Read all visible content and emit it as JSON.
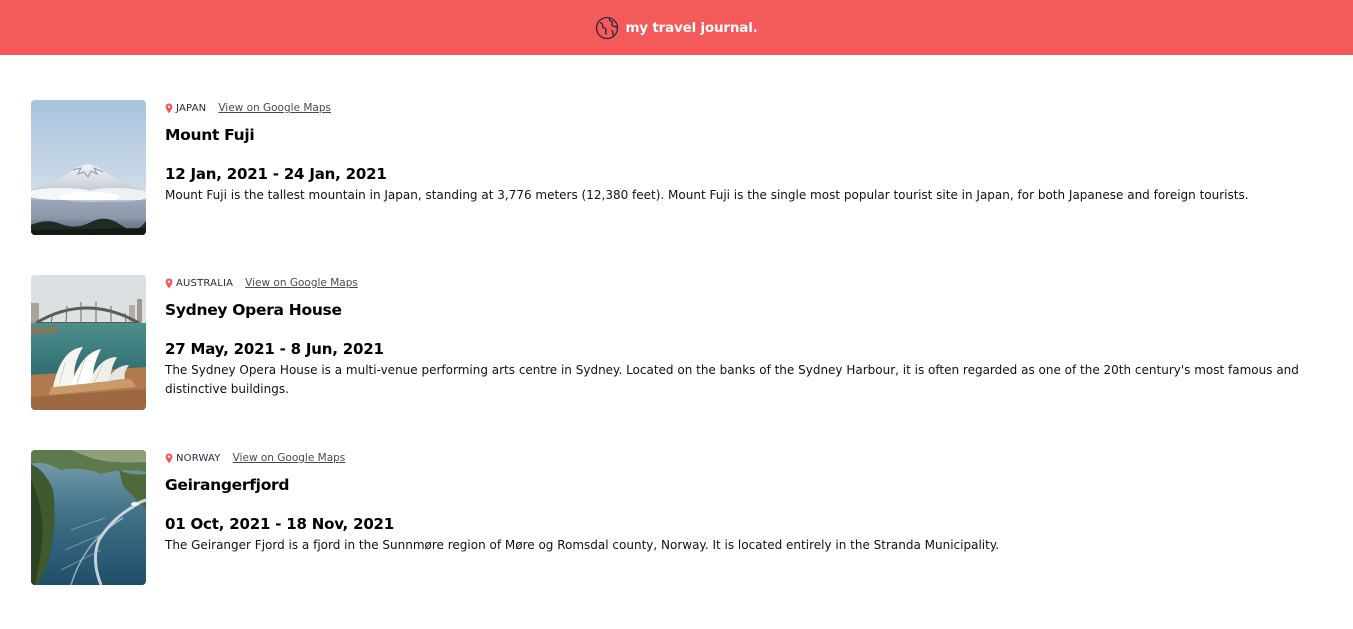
{
  "navbar": {
    "logo_icon": "globe-icon",
    "title": "my travel journal.",
    "background": "#f55a5a"
  },
  "entries": [
    {
      "country": "Japan",
      "maps_link": "View on Google Maps",
      "title": "Mount Fuji",
      "dates": "12 Jan, 2021 - 24 Jan, 2021",
      "description": "Mount Fuji is the tallest mountain in Japan, standing at 3,776 meters (12,380 feet). Mount Fuji is the single most popular tourist site in Japan, for both Japanese and foreign tourists."
    },
    {
      "country": "Australia",
      "maps_link": "View on Google Maps",
      "title": "Sydney Opera House",
      "dates": "27 May, 2021 - 8 Jun, 2021",
      "description": "The Sydney Opera House is a multi-venue performing arts centre in Sydney. Located on the banks of the Sydney Harbour, it is often regarded as one of the 20th century's most famous and distinctive buildings."
    },
    {
      "country": "Norway",
      "maps_link": "View on Google Maps",
      "title": "Geirangerfjord",
      "dates": "01 Oct, 2021 - 18 Nov, 2021",
      "description": "The Geiranger Fjord is a fjord in the Sunnmøre region of Møre og Romsdal county, Norway. It is located entirely in the Stranda Municipality."
    }
  ],
  "icons": {
    "location": "location-pin-icon",
    "pin_color": "#f55a5a"
  }
}
